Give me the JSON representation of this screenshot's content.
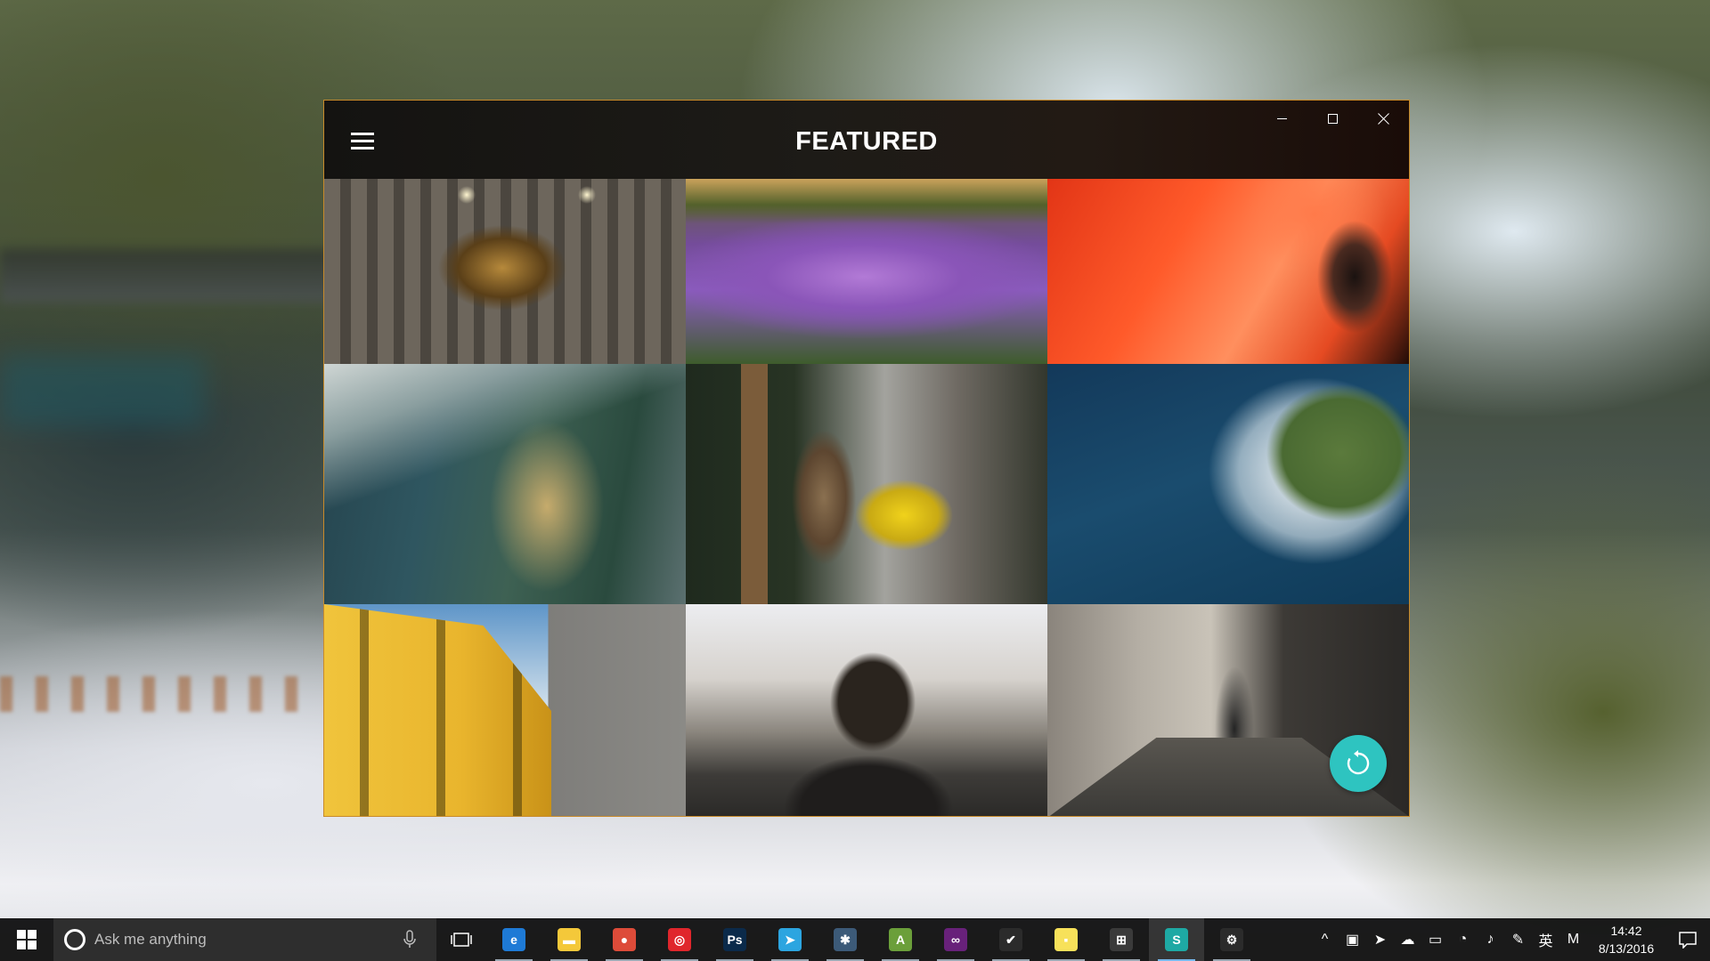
{
  "app": {
    "title": "FEATURED",
    "menu_icon": "hamburger-menu-icon",
    "window_controls": [
      "minimize-icon",
      "maximize-icon",
      "close-icon"
    ],
    "border_color": "#c88a2a",
    "accent_color": "#2ec4c0"
  },
  "gallery": {
    "photos": [
      {
        "subject": "chandelier"
      },
      {
        "subject": "purple-flowers"
      },
      {
        "subject": "flamingo"
      },
      {
        "subject": "mountain-valley"
      },
      {
        "subject": "cat"
      },
      {
        "subject": "coastline-aerial"
      },
      {
        "subject": "yellow-building"
      },
      {
        "subject": "person-silhouette"
      },
      {
        "subject": "alley-walker"
      }
    ],
    "refresh_icon": "refresh-icon"
  },
  "taskbar": {
    "search_placeholder": "Ask me anything",
    "apps": [
      {
        "name": "edge-icon",
        "color": "#1e7ad6",
        "glyph": "e"
      },
      {
        "name": "file-explorer-icon",
        "color": "#f4c83a",
        "glyph": "▬"
      },
      {
        "name": "chrome-icon",
        "color": "#dd4b39",
        "glyph": "●"
      },
      {
        "name": "netease-music-icon",
        "color": "#e0262c",
        "glyph": "◎"
      },
      {
        "name": "photoshop-icon",
        "color": "#0b2a4a",
        "glyph": "Ps"
      },
      {
        "name": "telegram-icon",
        "color": "#2ca5e0",
        "glyph": "➤"
      },
      {
        "name": "app-dark-circle-icon",
        "color": "#3c5a78",
        "glyph": "✱"
      },
      {
        "name": "android-studio-icon",
        "color": "#6b9f3a",
        "glyph": "A"
      },
      {
        "name": "visual-studio-icon",
        "color": "#68217a",
        "glyph": "∞"
      },
      {
        "name": "todo-check-icon",
        "color": "#2b2b2b",
        "glyph": "✔"
      },
      {
        "name": "sticky-notes-icon",
        "color": "#f7e15a",
        "glyph": "▪"
      },
      {
        "name": "store-icon",
        "color": "#3a3a3a",
        "glyph": "⊞"
      },
      {
        "name": "splash-app-icon",
        "color": "#1ea9a4",
        "glyph": "S"
      },
      {
        "name": "settings-icon",
        "color": "#2b2b2b",
        "glyph": "⚙"
      }
    ],
    "tray": [
      {
        "name": "show-hidden-icons-icon",
        "glyph": "^"
      },
      {
        "name": "tray-app-icon",
        "glyph": "▣"
      },
      {
        "name": "telegram-tray-icon",
        "glyph": "➤"
      },
      {
        "name": "onedrive-icon",
        "glyph": "☁"
      },
      {
        "name": "battery-icon",
        "glyph": "▭"
      },
      {
        "name": "wifi-icon",
        "glyph": "◔"
      },
      {
        "name": "volume-icon",
        "glyph": "♪"
      },
      {
        "name": "pen-icon",
        "glyph": "✎"
      },
      {
        "name": "input-language-icon",
        "glyph": "英"
      },
      {
        "name": "ime-mode-icon",
        "glyph": "M"
      }
    ],
    "clock_time": "14:42",
    "clock_date": "8/13/2016"
  }
}
